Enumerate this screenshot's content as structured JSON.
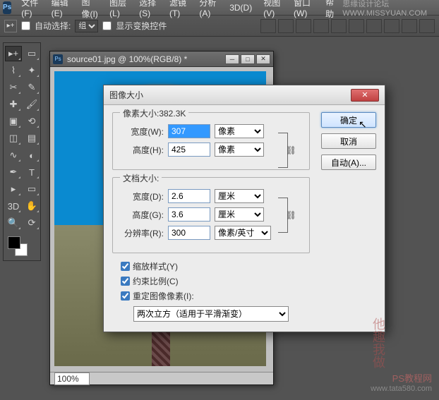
{
  "menubar": {
    "items": [
      "文件(F)",
      "编辑(E)",
      "图像(I)",
      "图层(L)",
      "选择(S)",
      "滤镜(T)",
      "分析(A)",
      "3D(D)",
      "视图(V)",
      "窗口(W)",
      "帮助"
    ],
    "right_text": "思缘设计论坛  WWW.MISSYUAN.COM"
  },
  "optbar": {
    "auto_select_label": "自动选择:",
    "auto_select_option": "组",
    "show_transform_label": "显示变换控件"
  },
  "tools": {
    "names": [
      "move-tool",
      "marquee-tool",
      "lasso-tool",
      "quick-select-tool",
      "crop-tool",
      "eyedropper-tool",
      "healing-brush-tool",
      "brush-tool",
      "clone-stamp-tool",
      "history-brush-tool",
      "eraser-tool",
      "gradient-tool",
      "blur-tool",
      "dodge-tool",
      "pen-tool",
      "type-tool",
      "path-select-tool",
      "shape-tool",
      "3d-tool",
      "hand-tool",
      "zoom-tool",
      "rotate-view-tool"
    ],
    "glyphs": [
      "▸+",
      "▭",
      "⌇",
      "✦",
      "✂",
      "✎",
      "✚",
      "🖌",
      "▣",
      "⟲",
      "◫",
      "▤",
      "∿",
      "◐",
      "✒",
      "T",
      "▸",
      "▭",
      "3D",
      "✋",
      "🔍",
      "⟳"
    ]
  },
  "doc": {
    "title": "source01.jpg @ 100%(RGB/8) *",
    "zoom": "100%"
  },
  "dialog": {
    "title": "图像大小",
    "pixel_dim_legend": "像素大小:382.3K",
    "width_label": "宽度(W):",
    "height_label": "高度(H):",
    "width_value": "307",
    "height_value": "425",
    "pixel_unit": "像素",
    "doc_size_legend": "文档大小:",
    "doc_width_label": "宽度(D):",
    "doc_height_label": "高度(G):",
    "doc_width_value": "2.6",
    "doc_height_value": "3.6",
    "cm_unit": "厘米",
    "res_label": "分辨率(R):",
    "res_value": "300",
    "res_unit": "像素/英寸",
    "scale_styles_label": "缩放样式(Y)",
    "constrain_label": "约束比例(C)",
    "resample_label": "重定图像像素(I):",
    "resample_method": "两次立方（适用于平滑渐变）",
    "ok_label": "确定",
    "cancel_label": "取消",
    "auto_label": "自动(A)..."
  },
  "watermark": {
    "vertical": "他趣我做",
    "line1": "PS教程网",
    "line2": "www.tata580.com"
  }
}
